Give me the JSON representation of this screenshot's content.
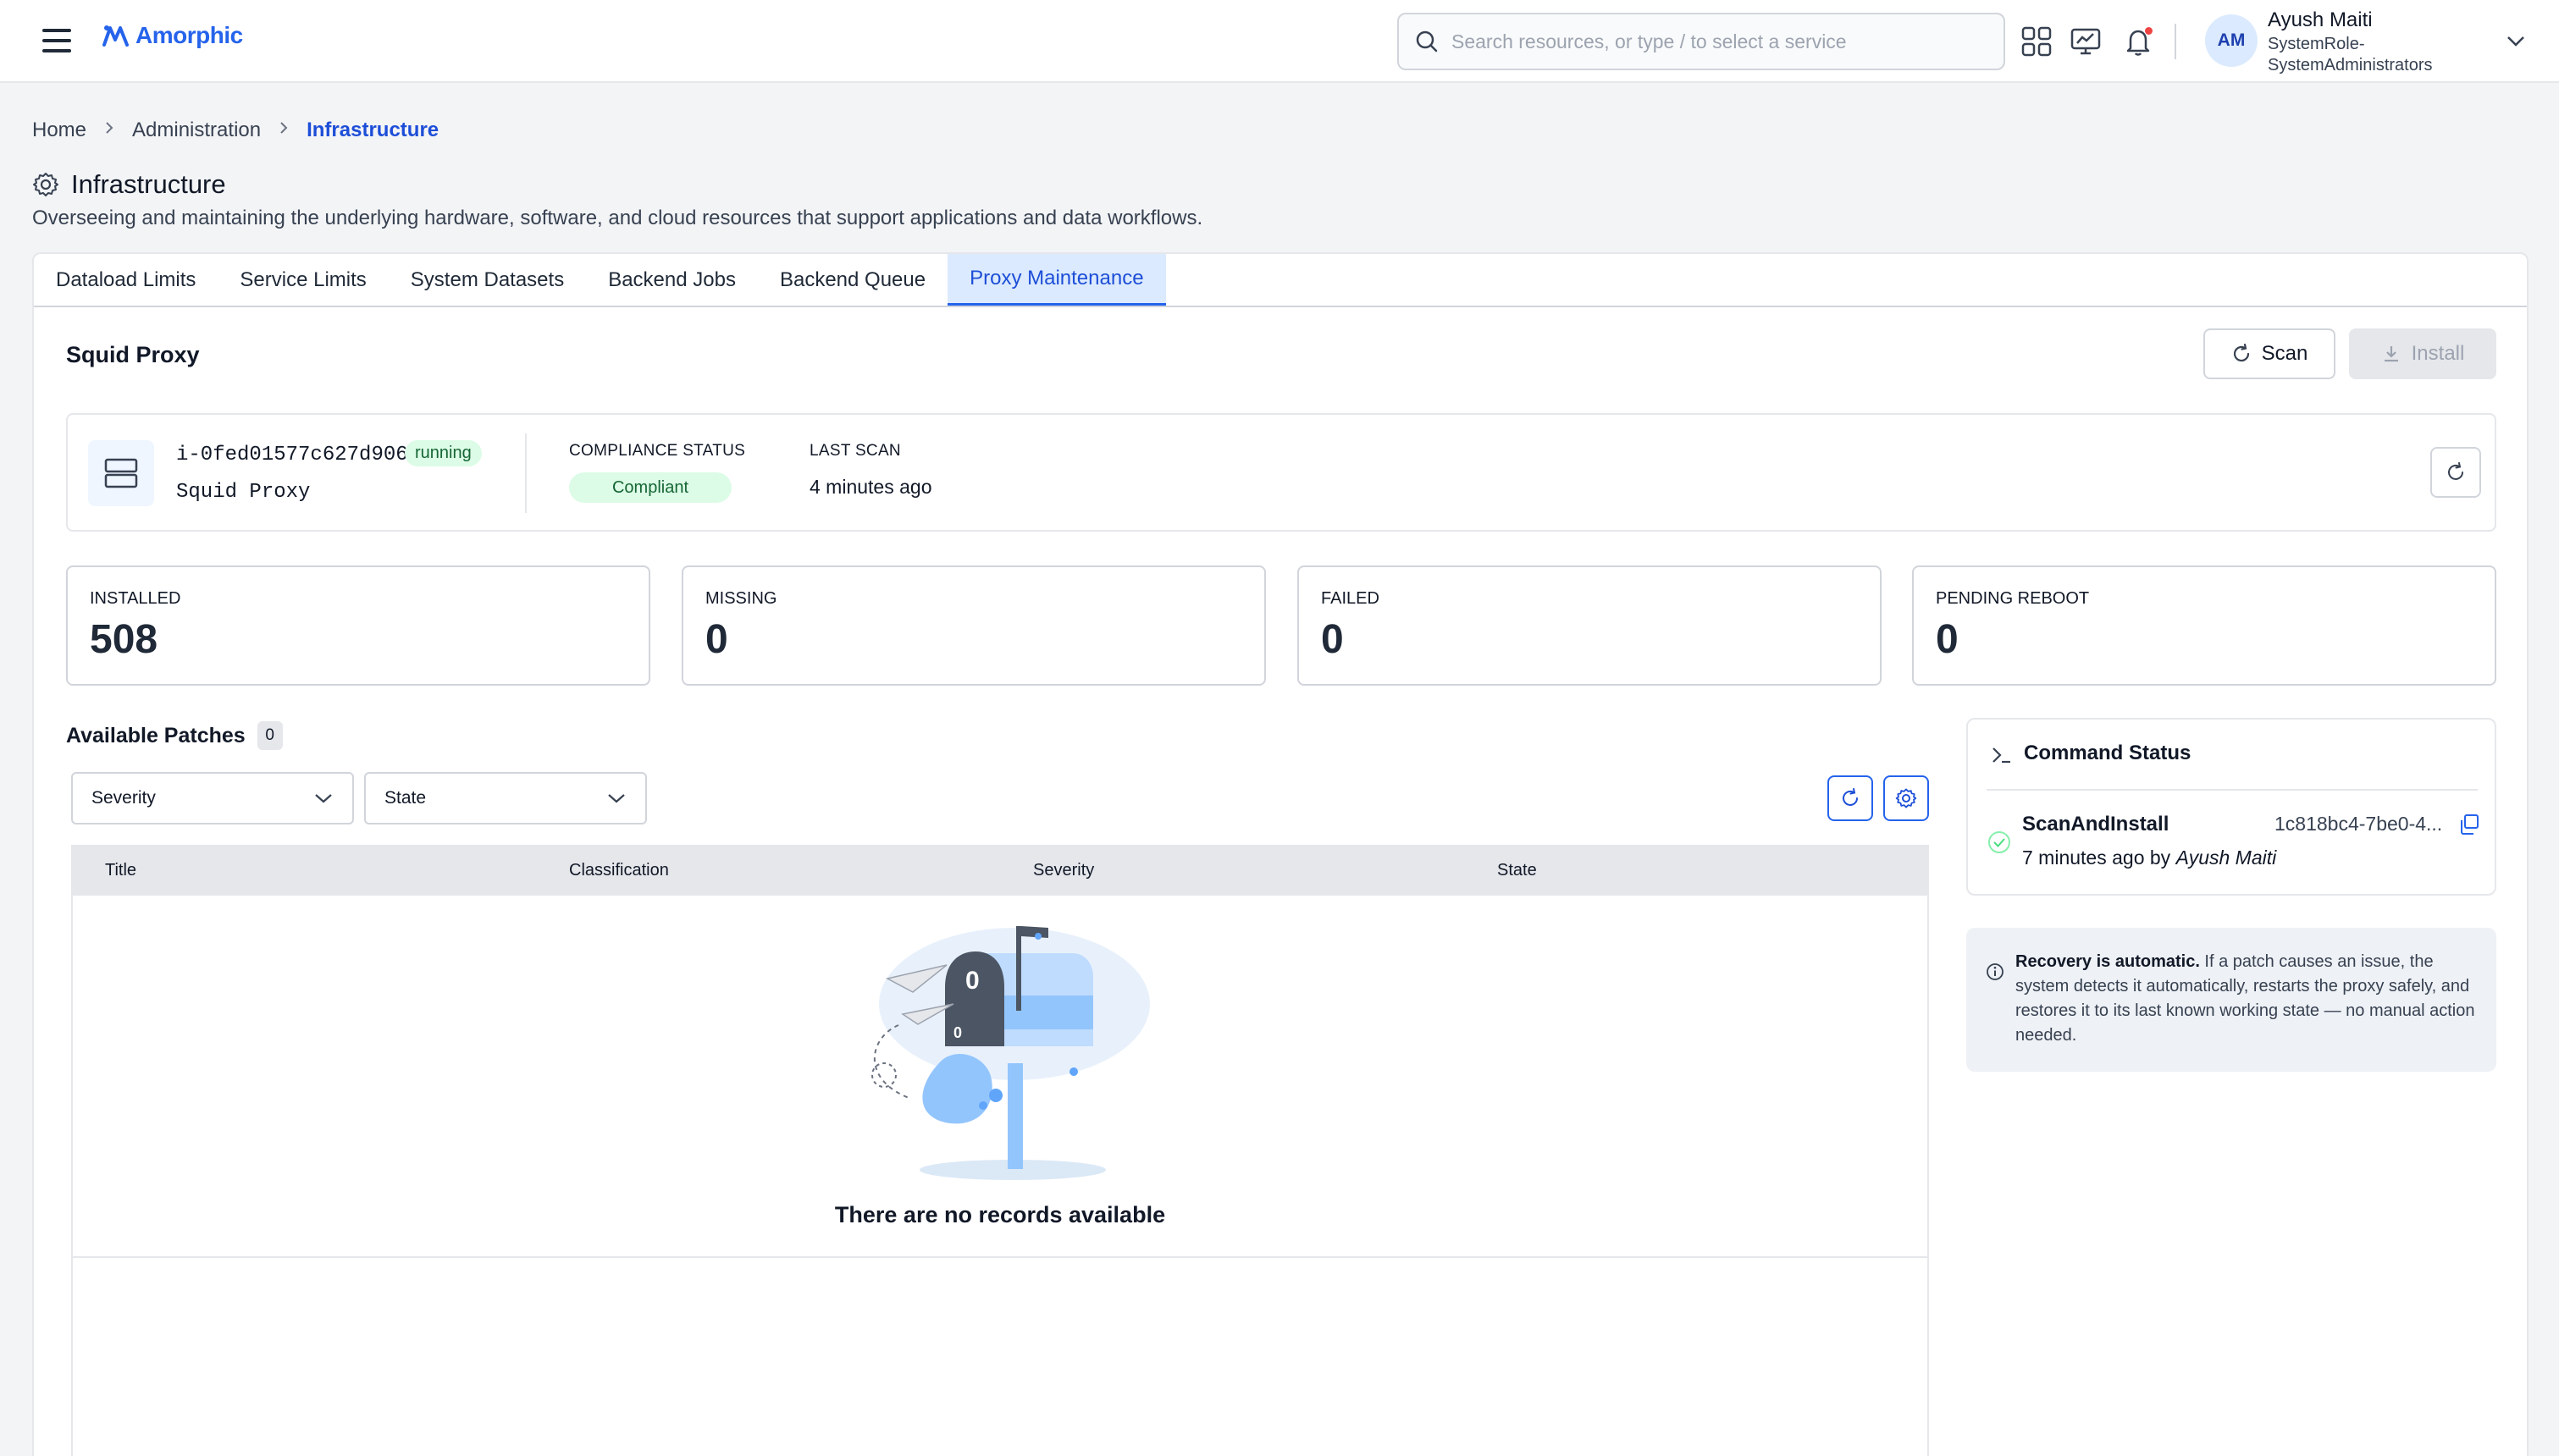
{
  "app": {
    "logo": "Amorphic",
    "search_placeholder": "Search resources, or type / to select a service"
  },
  "user": {
    "initials": "AM",
    "name": "Ayush Maiti",
    "role": "SystemRole-SystemAdministrators"
  },
  "breadcrumb": [
    "Home",
    "Administration",
    "Infrastructure"
  ],
  "page": {
    "title": "Infrastructure",
    "description": "Overseeing and maintaining the underlying hardware, software, and cloud resources that support applications and data workflows."
  },
  "tabs": [
    {
      "label": "Dataload Limits",
      "active": false
    },
    {
      "label": "Service Limits",
      "active": false
    },
    {
      "label": "System Datasets",
      "active": false
    },
    {
      "label": "Backend Jobs",
      "active": false
    },
    {
      "label": "Backend Queue",
      "active": false
    },
    {
      "label": "Proxy Maintenance",
      "active": true
    }
  ],
  "proxy": {
    "section_title": "Squid Proxy",
    "scan_label": "Scan",
    "install_label": "Install",
    "instance_id": "i-0fed01577c627d906",
    "instance_state": "running",
    "instance_name": "Squid Proxy",
    "compliance_label": "COMPLIANCE STATUS",
    "compliance_value": "Compliant",
    "last_scan_label": "LAST SCAN",
    "last_scan_value": "4 minutes ago"
  },
  "stats": [
    {
      "label": "INSTALLED",
      "value": "508"
    },
    {
      "label": "MISSING",
      "value": "0"
    },
    {
      "label": "FAILED",
      "value": "0"
    },
    {
      "label": "PENDING REBOOT",
      "value": "0"
    }
  ],
  "patches": {
    "title": "Available Patches",
    "count": "0",
    "filter_severity": "Severity",
    "filter_state": "State",
    "columns": [
      "Title",
      "Classification",
      "Severity",
      "State"
    ],
    "empty_text": "There are no records available"
  },
  "command_status": {
    "title": "Command Status",
    "command": "ScanAndInstall",
    "command_id": "1c818bc4-7be0-4...",
    "time": "7 minutes ago by",
    "by": "Ayush Maiti"
  },
  "info": {
    "bold": "Recovery is automatic.",
    "text": " If a patch causes an issue, the system detects it automatically, restarts the proxy safely, and restores it to its last known working state — no manual action needed."
  },
  "colors": {
    "accent": "#2563eb",
    "success_bg": "#dcfce7",
    "success_text": "#166534",
    "notification": "#ef4444"
  }
}
